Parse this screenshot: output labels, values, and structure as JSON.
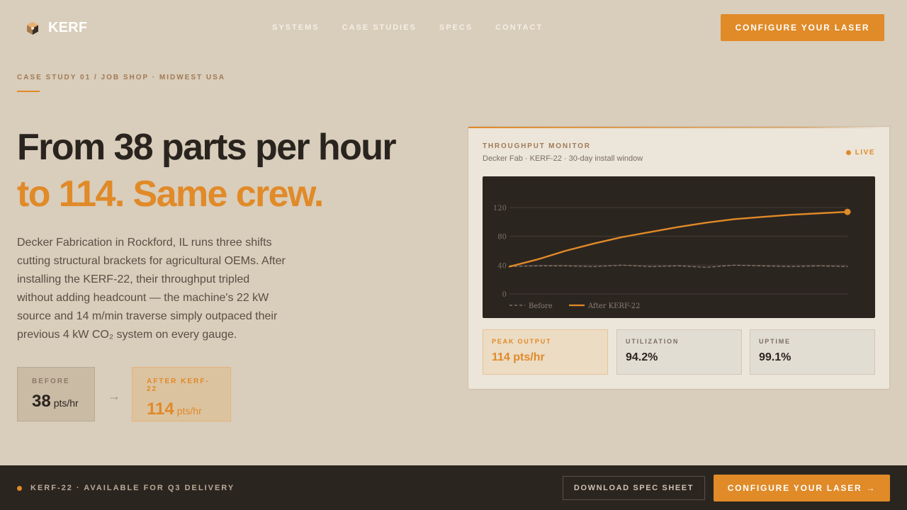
{
  "brand": {
    "name": "KERF",
    "logo_icon": "kerf-hex-logo-icon"
  },
  "nav": {
    "items": [
      "SYSTEMS",
      "CASE STUDIES",
      "SPECS",
      "CONTACT"
    ],
    "cta": "CONFIGURE YOUR LASER"
  },
  "hero": {
    "eyebrow": "CASE STUDY 01 / JOB SHOP · MIDWEST USA",
    "headline_1": "From 38 parts per hour",
    "headline_2": "to 114. Same crew.",
    "body": "Decker Fabrication in Rockford, IL runs three shifts cutting structural brackets for agricultural OEMs. After installing the KERF-22, their throughput tripled without adding headcount — the machine's 22 kW source and 14 m/min traverse simply outpaced their previous 4 kW CO₂ system on every gauge."
  },
  "stats": {
    "before": {
      "label": "BEFORE",
      "value": "38",
      "unit": "pts/hr"
    },
    "arrow": "→",
    "after": {
      "label": "AFTER KERF-22",
      "value": "114",
      "unit": "pts/hr"
    }
  },
  "monitor": {
    "title": "THROUGHPUT MONITOR",
    "subtitle": "Decker Fab · KERF-22 · 30-day install window",
    "status": "LIVE",
    "kpis": [
      {
        "label": "PEAK OUTPUT",
        "value": "114 pts/hr"
      },
      {
        "label": "UTILIZATION",
        "value": "94.2%"
      },
      {
        "label": "UPTIME",
        "value": "99.1%"
      }
    ]
  },
  "chart_data": {
    "type": "line",
    "title": "",
    "xlabel": "",
    "ylabel": "",
    "ylim": [
      0,
      120
    ],
    "y_ticks": [
      0,
      40,
      80,
      120
    ],
    "grid": true,
    "legend": "bottom-left",
    "x": [
      0,
      1,
      2,
      3,
      4,
      5,
      6,
      7,
      8,
      9,
      10,
      11,
      12
    ],
    "series": [
      {
        "name": "Before",
        "style": "dashed",
        "color": "#8a7e72",
        "values": [
          38,
          39,
          39,
          38,
          40,
          38,
          39,
          37,
          40,
          39,
          38,
          39,
          38
        ]
      },
      {
        "name": "After KERF-22",
        "style": "solid",
        "color": "#e08a28",
        "values": [
          38,
          48,
          60,
          70,
          79,
          86,
          93,
          99,
          104,
          107,
          110,
          112,
          114
        ]
      }
    ]
  },
  "footer": {
    "status": "KERF-22 · AVAILABLE FOR Q3 DELIVERY",
    "secondary_cta": "DOWNLOAD SPEC SHEET",
    "primary_cta": "CONFIGURE YOUR LASER",
    "primary_cta_arrow": "→"
  },
  "colors": {
    "accent": "#e08a28",
    "background": "#d9cdbb",
    "dark": "#2b2520"
  }
}
